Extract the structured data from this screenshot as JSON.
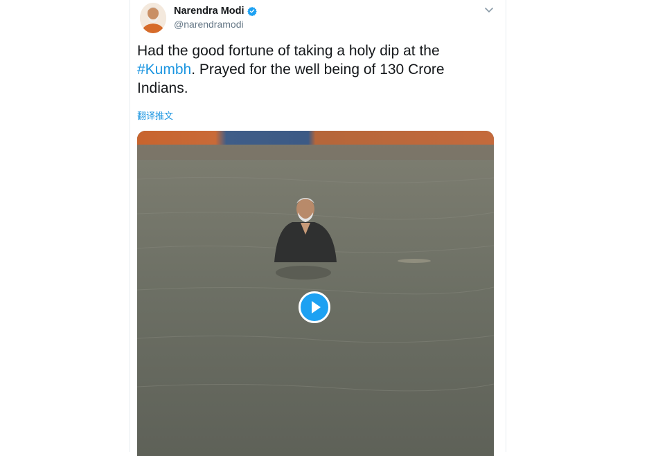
{
  "author": {
    "display_name": "Narendra Modi",
    "handle": "@narendramodi",
    "verified": true,
    "avatar_icon": "profile-photo"
  },
  "tweet": {
    "text_before_hashtag": "Had the good fortune of taking a holy dip at the",
    "hashtag": "#Kumbh",
    "text_after_hashtag": ". Prayed for the well being of 130 Crore Indians.",
    "translate_label": "翻译推文"
  },
  "media": {
    "type": "video",
    "icon": "play-icon"
  },
  "colors": {
    "link": "#1b95e0",
    "verified": "#1da1f2",
    "text": "#14171a",
    "secondary": "#657786"
  }
}
